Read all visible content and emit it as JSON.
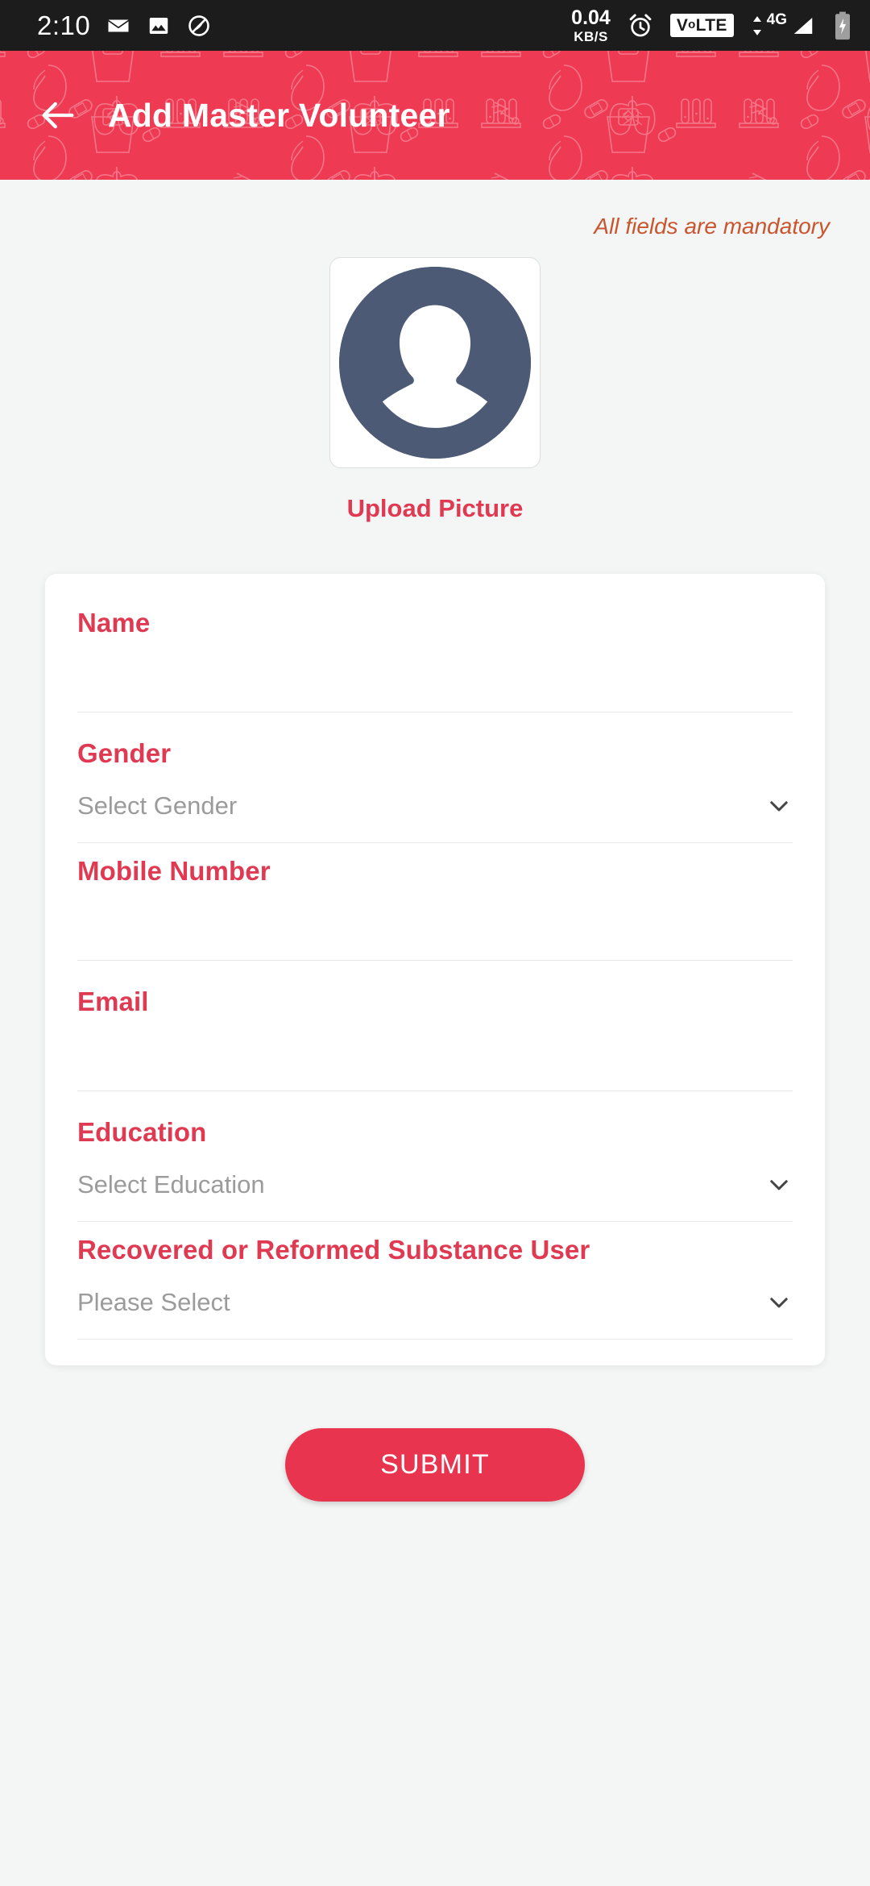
{
  "status_bar": {
    "time": "2:10",
    "left_icons": [
      "envelope-icon",
      "image-icon",
      "do-not-disturb-icon"
    ],
    "net_speed_value": "0.04",
    "net_speed_unit": "KB/S",
    "alarm_icon": "alarm-clock-icon",
    "volte_label_v": "V",
    "volte_label_o": "o",
    "volte_label_lte": "LTE",
    "data_generation": "4G",
    "battery_icon": "battery-charging-icon"
  },
  "header": {
    "back_icon": "back-arrow-icon",
    "title": "Add Master Volunteer",
    "background_color": "#EE3A53",
    "pattern": "medical-line-art-pattern"
  },
  "content": {
    "mandatory_note": "All fields are mandatory",
    "mandatory_note_color": "#C9552E",
    "avatar": {
      "icon": "default-person-avatar",
      "circle_color": "#4C5A75"
    },
    "upload_label": "Upload Picture",
    "upload_label_color": "#E03A52"
  },
  "form": {
    "label_color": "#E03A52",
    "fields": [
      {
        "label": "Name",
        "type": "text",
        "value": "",
        "placeholder": ""
      },
      {
        "label": "Gender",
        "type": "select",
        "value": "",
        "placeholder": "Select Gender"
      },
      {
        "label": "Mobile Number",
        "type": "text",
        "value": "",
        "placeholder": ""
      },
      {
        "label": "Email",
        "type": "text",
        "value": "",
        "placeholder": ""
      },
      {
        "label": "Education",
        "type": "select",
        "value": "",
        "placeholder": "Select Education"
      },
      {
        "label": "Recovered or Reformed Substance User",
        "type": "select",
        "value": "",
        "placeholder": "Please Select"
      }
    ]
  },
  "submit": {
    "label": "SUBMIT",
    "color": "#E8344E"
  }
}
